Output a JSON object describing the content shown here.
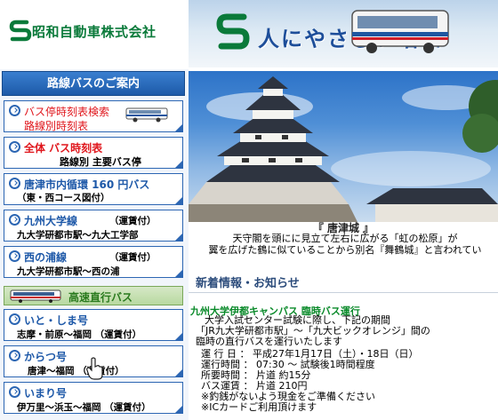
{
  "header": {
    "company_name": "昭和自動車株式会社",
    "banner_text": "人にやさしい昭和"
  },
  "sidebar": {
    "title": "路線バスのご案内",
    "items": [
      {
        "line1": "バス停時刻表検索",
        "line2": "路線別時刻表"
      },
      {
        "line1": "全体  バス時刻表",
        "line2": "路線別  主要バス停"
      },
      {
        "line1": "唐津市内循環 160 円バス",
        "line2": "（東・西コース図付）"
      },
      {
        "line1": "九州大学線",
        "line1_note": "（運賃付）",
        "line2": "九大学研都市駅〜九大工学部"
      },
      {
        "line1": "西の浦線",
        "line1_note": "（運賃付）",
        "line2": "九大学研都市駅〜西の浦"
      },
      {
        "line1": "いと・しま号",
        "line2": "志摩・前原〜福岡 （運賃付）"
      },
      {
        "line1": "からつ号",
        "line2": "唐津〜福岡 （運賃付）"
      },
      {
        "line1": "いまり号",
        "line2": "伊万里〜浜玉〜福岡 （運賃付）"
      }
    ],
    "express_label": "高速直行バス"
  },
  "photo": {
    "caption_title": "『 唐津城 』",
    "caption_lines": [
      "天守閣を頭にに見立て左右に広がる「虹の松原」が",
      "翼を広げた鶴に似ていることから別名『舞鶴城』と言われてい"
    ]
  },
  "news": {
    "heading": "新着情報・お知らせ",
    "item_title": "九州大学伊都キャンパス 臨時バス運行",
    "lines": [
      "大学入試センター試験に際し、下記の期間",
      "「JR九大学研都市駅」〜「九大ビックオレンジ」間の",
      "臨時の直行バスを運行いたします",
      "運 行 日 ： 平成27年1月17日（土）・18日（日）",
      "運行時間 ： 07:30 〜 試験後1時間程度",
      "所要時間 ： 片道 約15分",
      "バス運賃 ： 片道 210円"
    ],
    "notice_lines": [
      "※釣銭がないよう現金をご準備ください",
      "※ICカードご利用頂けます"
    ]
  },
  "colors": {
    "brand_green": "#0a7a3a",
    "nav_blue": "#2c66b3",
    "alert_red": "#e0161c",
    "news_green": "#0a8a2a"
  }
}
